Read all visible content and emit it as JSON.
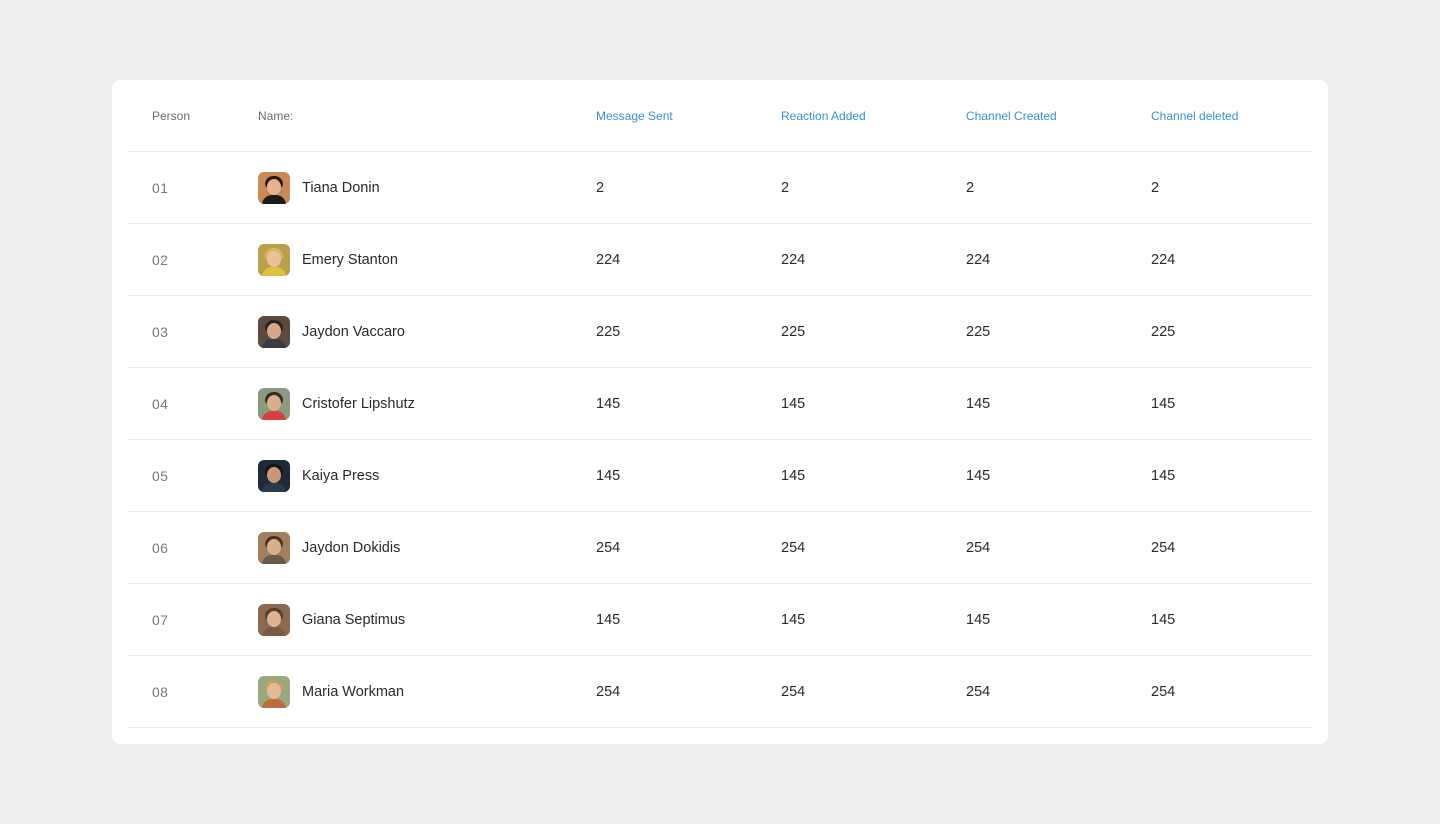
{
  "table": {
    "headers": {
      "person": "Person",
      "name": "Name:",
      "message_sent": "Message Sent",
      "reaction_added": "Reaction Added",
      "channel_created": "Channel Created",
      "channel_deleted": "Channel deleted"
    },
    "colors": {
      "accent": "#3b8fd6",
      "muted": "#6b6b6b",
      "text": "#2a2a2a"
    },
    "rows": [
      {
        "index": "01",
        "name": "Tiana Donin",
        "message_sent": "2",
        "reaction_added": "2",
        "channel_created": "2",
        "channel_deleted": "2",
        "avatar_icon": "avatar-photo-icon"
      },
      {
        "index": "02",
        "name": "Emery Stanton",
        "message_sent": "224",
        "reaction_added": "224",
        "channel_created": "224",
        "channel_deleted": "224",
        "avatar_icon": "avatar-photo-icon"
      },
      {
        "index": "03",
        "name": "Jaydon Vaccaro",
        "message_sent": "225",
        "reaction_added": "225",
        "channel_created": "225",
        "channel_deleted": "225",
        "avatar_icon": "avatar-photo-icon"
      },
      {
        "index": "04",
        "name": "Cristofer Lipshutz",
        "message_sent": "145",
        "reaction_added": "145",
        "channel_created": "145",
        "channel_deleted": "145",
        "avatar_icon": "avatar-photo-icon"
      },
      {
        "index": "05",
        "name": "Kaiya Press",
        "message_sent": "145",
        "reaction_added": "145",
        "channel_created": "145",
        "channel_deleted": "145",
        "avatar_icon": "avatar-photo-icon"
      },
      {
        "index": "06",
        "name": "Jaydon Dokidis",
        "message_sent": "254",
        "reaction_added": "254",
        "channel_created": "254",
        "channel_deleted": "254",
        "avatar_icon": "avatar-photo-icon"
      },
      {
        "index": "07",
        "name": "Giana Septimus",
        "message_sent": "145",
        "reaction_added": "145",
        "channel_created": "145",
        "channel_deleted": "145",
        "avatar_icon": "avatar-photo-icon"
      },
      {
        "index": "08",
        "name": "Maria Workman",
        "message_sent": "254",
        "reaction_added": "254",
        "channel_created": "254",
        "channel_deleted": "254",
        "avatar_icon": "avatar-photo-icon"
      }
    ]
  }
}
